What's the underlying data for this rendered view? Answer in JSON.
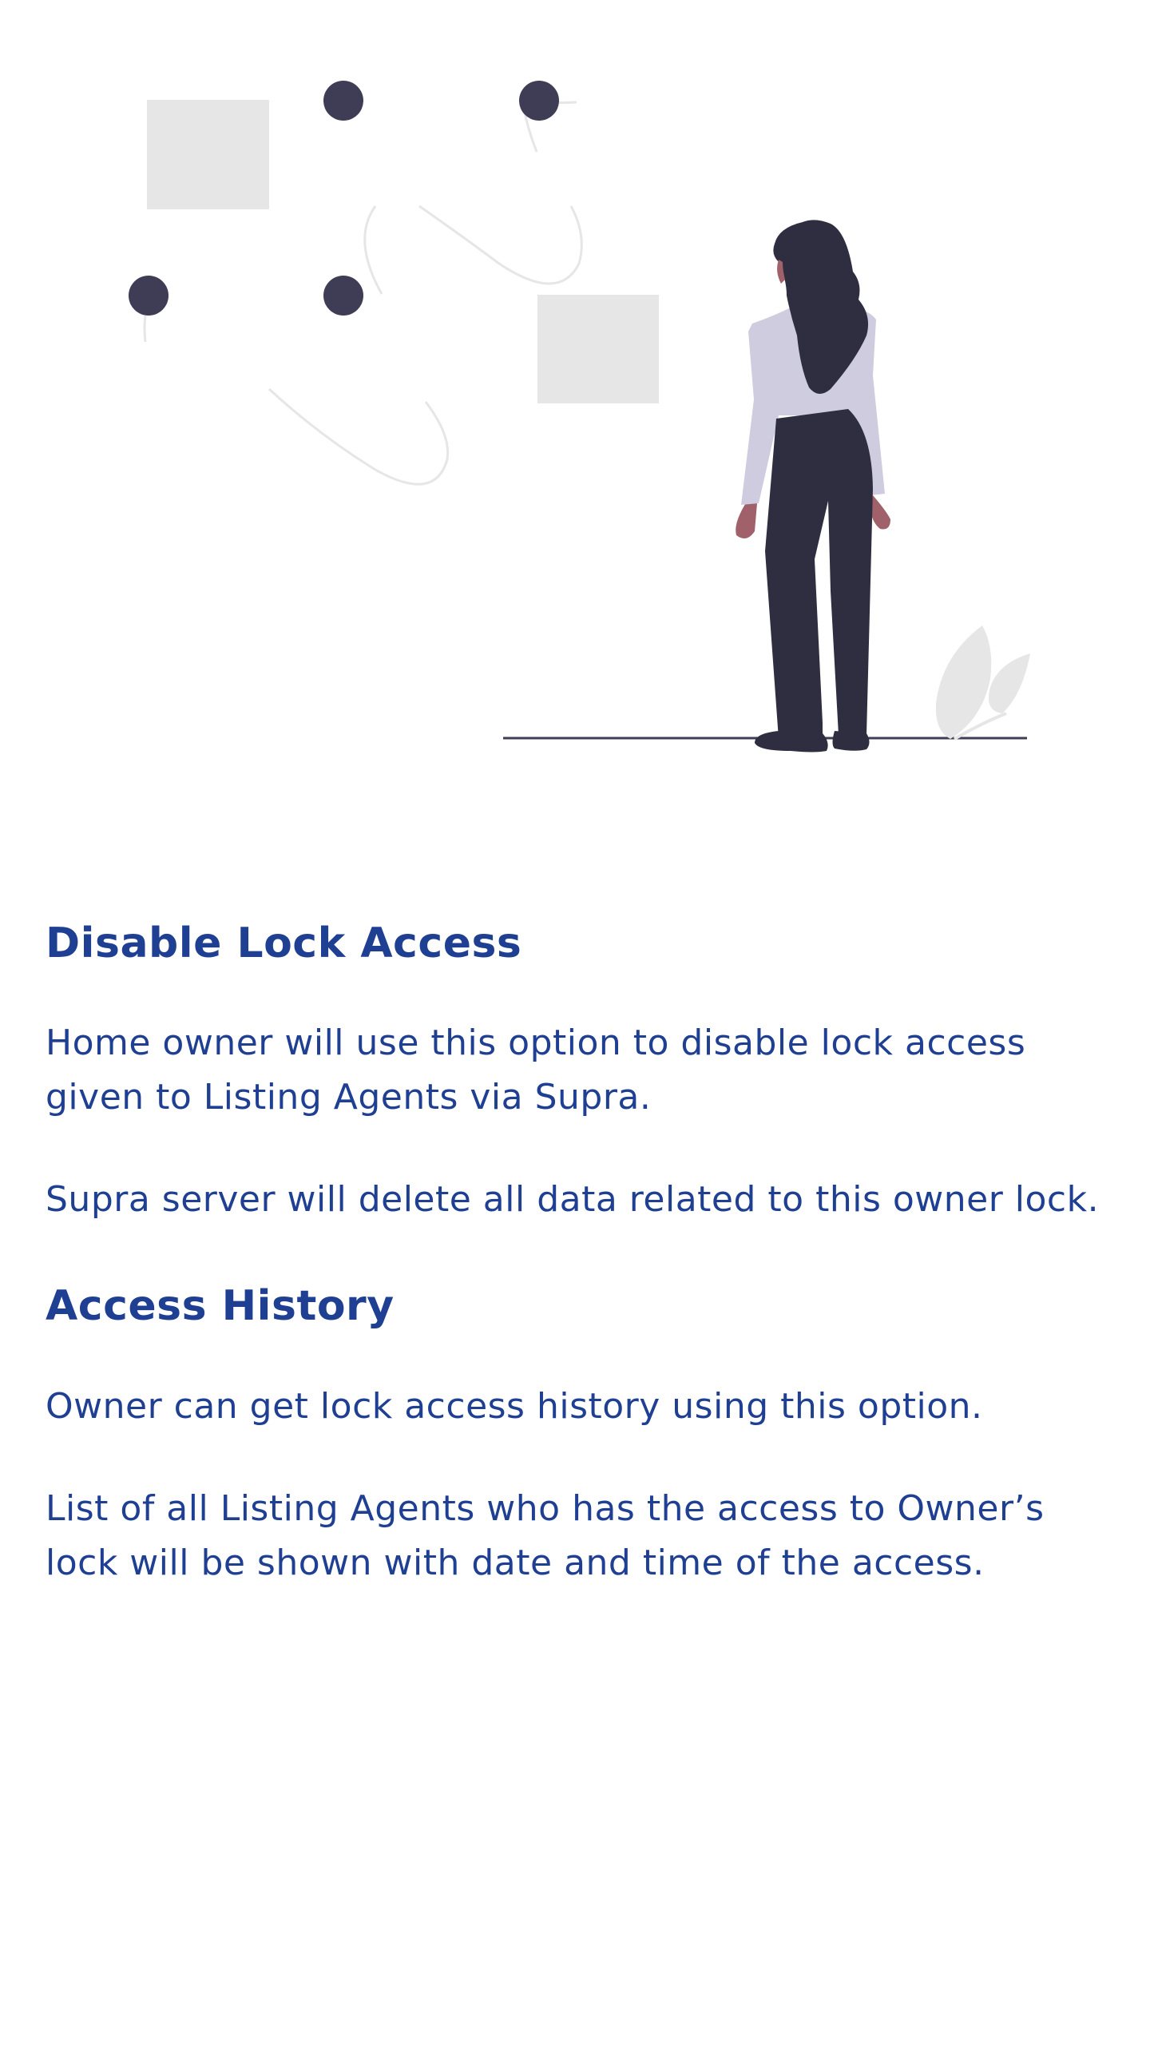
{
  "colors": {
    "accent": "#1f3f93",
    "node": "#3f3d56",
    "block": "#e6e6e6",
    "figure_dark": "#2f2e41",
    "figure_shirt": "#cfcce0",
    "skin": "#a0616a",
    "ground": "#3f3d56"
  },
  "illustration": {
    "icons": [
      "woman-figure-illustration",
      "node-network-illustration",
      "leaf-plant-illustration"
    ]
  },
  "sections": [
    {
      "title": "Disable Lock Access",
      "paragraphs": [
        "Home owner will use this option to disable lock access given to Listing Agents via Supra.",
        "Supra server will delete all data related to this owner lock."
      ]
    },
    {
      "title": "Access History",
      "paragraphs": [
        "Owner can get lock access history using this option.",
        "List of all Listing Agents who has the access to Owner’s lock will be shown with date and time of the access."
      ]
    }
  ]
}
